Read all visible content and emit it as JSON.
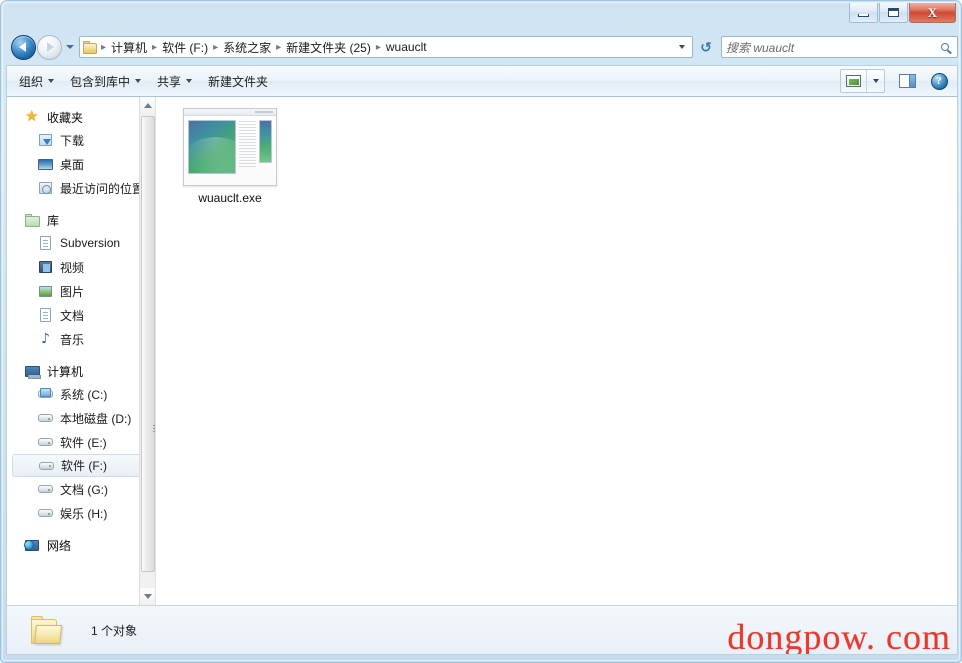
{
  "window": {
    "title": "",
    "caption_buttons": [
      {
        "name": "minimize",
        "label": "—"
      },
      {
        "name": "maximize",
        "label": "□"
      },
      {
        "name": "close",
        "label": "X"
      }
    ]
  },
  "navigation": {
    "back_tooltip": "后退",
    "forward_tooltip": "前进",
    "recent_pages_tooltip": "最近浏览的位置"
  },
  "address": {
    "breadcrumbs": [
      "计算机",
      "软件 (F:)",
      "系统之家",
      "新建文件夹 (25)",
      "wuauclt"
    ],
    "separator": "▸",
    "refresh_label": "↺"
  },
  "search": {
    "placeholder": "搜索 wuauclt",
    "icon": "search-icon"
  },
  "toolbar": {
    "items": [
      {
        "label": "组织",
        "has_caret": true
      },
      {
        "label": "包含到库中",
        "has_caret": true
      },
      {
        "label": "共享",
        "has_caret": true
      },
      {
        "label": "新建文件夹",
        "has_caret": false
      }
    ],
    "view_button": "view-mode-icon",
    "preview_button": "preview-pane-icon",
    "help_button": "?"
  },
  "sidebar": {
    "sections": [
      {
        "root": {
          "label": "收藏夹",
          "icon": "star-icon"
        },
        "items": [
          {
            "label": "下载",
            "icon": "download-icon",
            "selected": false
          },
          {
            "label": "桌面",
            "icon": "desktop-icon",
            "selected": false
          },
          {
            "label": "最近访问的位置",
            "icon": "recent-places-icon",
            "selected": false
          }
        ]
      },
      {
        "root": {
          "label": "库",
          "icon": "library-icon"
        },
        "items": [
          {
            "label": "Subversion",
            "icon": "document-icon",
            "selected": false
          },
          {
            "label": "视频",
            "icon": "video-icon",
            "selected": false
          },
          {
            "label": "图片",
            "icon": "picture-icon",
            "selected": false
          },
          {
            "label": "文档",
            "icon": "document-icon",
            "selected": false
          },
          {
            "label": "音乐",
            "icon": "music-icon",
            "selected": false
          }
        ]
      },
      {
        "root": {
          "label": "计算机",
          "icon": "computer-icon"
        },
        "items": [
          {
            "label": "系统 (C:)",
            "icon": "system-drive-icon",
            "selected": false
          },
          {
            "label": "本地磁盘 (D:)",
            "icon": "drive-icon",
            "selected": false
          },
          {
            "label": "软件 (E:)",
            "icon": "drive-icon",
            "selected": false
          },
          {
            "label": "软件 (F:)",
            "icon": "drive-icon",
            "selected": true
          },
          {
            "label": "文档 (G:)",
            "icon": "drive-icon",
            "selected": false
          },
          {
            "label": "娱乐 (H:)",
            "icon": "drive-icon",
            "selected": false
          }
        ]
      },
      {
        "root": {
          "label": "网络",
          "icon": "network-icon"
        },
        "items": []
      }
    ]
  },
  "content": {
    "files": [
      {
        "name": "wuauclt.exe",
        "icon": "application-thumbnail"
      }
    ]
  },
  "status": {
    "item_count_text": "1 个对象",
    "folder_icon": "folder-icon"
  },
  "watermark": {
    "text": "dongpow. com",
    "color": "#e8392c"
  },
  "colors": {
    "frame": "#cfe3f2",
    "toolbar": "#eaf2f9",
    "content_bg": "#ffffff",
    "selection": "#e8eff6",
    "close_button": "#cf4a34"
  }
}
